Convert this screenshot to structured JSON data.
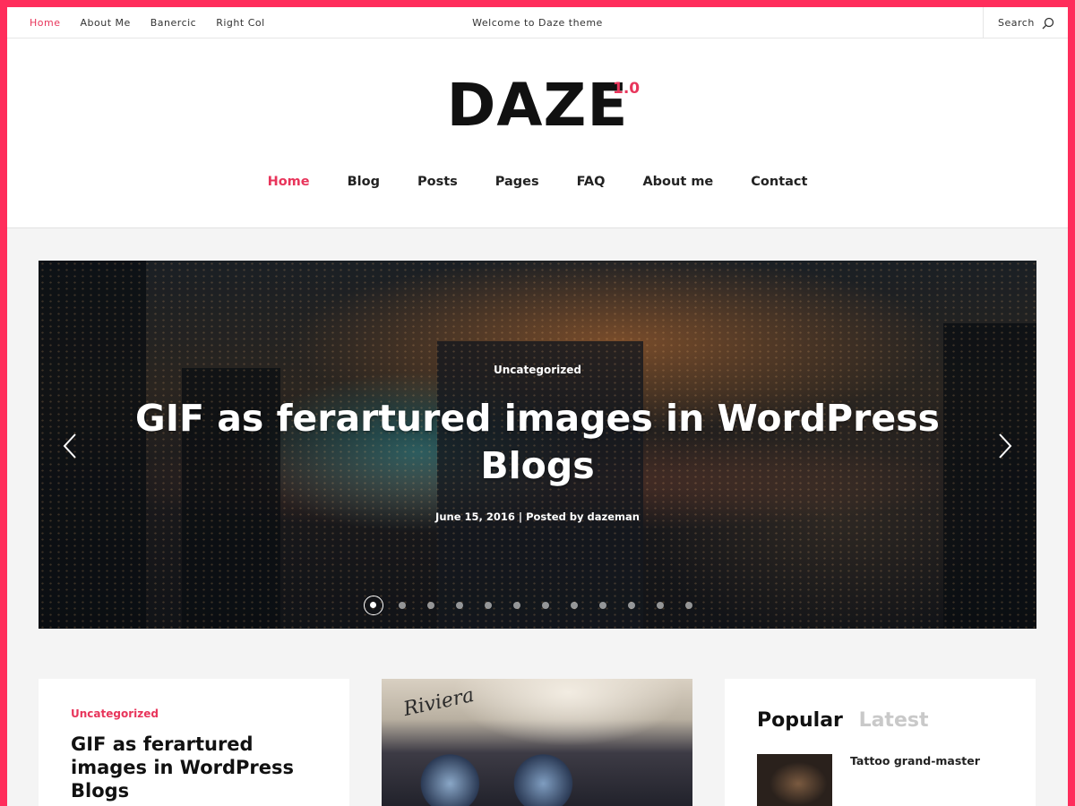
{
  "colors": {
    "accent": "#e8355b",
    "border": "#ff2d5b"
  },
  "topbar": {
    "links": [
      "Home",
      "About Me",
      "Banercic",
      "Right Col"
    ],
    "welcome": "Welcome to Daze theme",
    "search_label": "Search",
    "search_icon": "search-icon"
  },
  "header": {
    "logo": "DAZE",
    "version": "1.0",
    "nav": [
      "Home",
      "Blog",
      "Posts",
      "Pages",
      "FAQ",
      "About me",
      "Contact"
    ]
  },
  "slider": {
    "category": "Uncategorized",
    "title": "GIF as ferartured images in WordPress Blogs",
    "meta": "June 15, 2016 | Posted by dazeman",
    "prev_icon": "chevron-left-icon",
    "next_icon": "chevron-right-icon",
    "dot_count": 12,
    "active_dot": 1
  },
  "cards": {
    "post": {
      "category": "Uncategorized",
      "title": "GIF as ferartured images in WordPress Blogs"
    },
    "image_text": "Riviera",
    "widget": {
      "tab_popular": "Popular",
      "tab_latest": "Latest",
      "item_title": "Tattoo grand-master"
    }
  }
}
